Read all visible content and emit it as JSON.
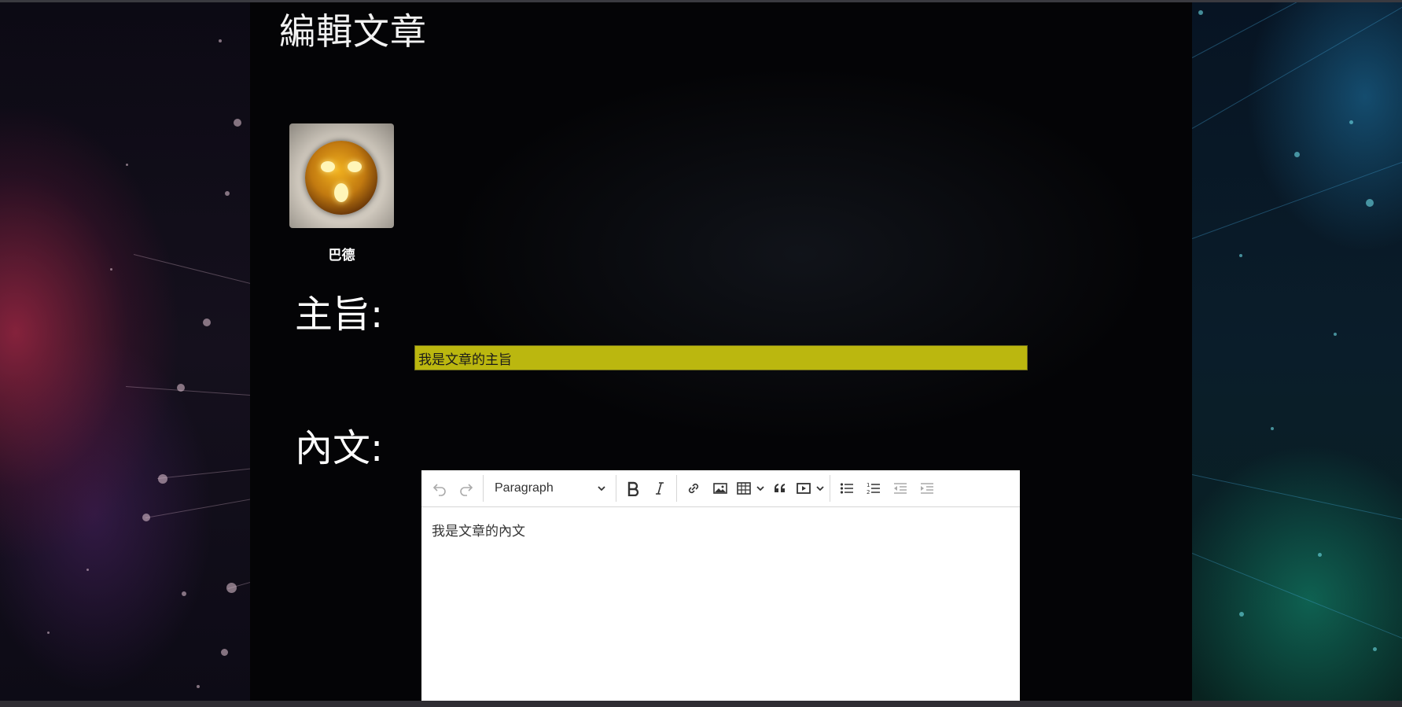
{
  "page": {
    "title": "編輯文章"
  },
  "author": {
    "name": "巴德",
    "avatar_icon": "bard-avatar-icon"
  },
  "form": {
    "subject_label": "主旨:",
    "subject_value": "我是文章的主旨",
    "content_label": "內文:",
    "subject_color": "#bbb70f"
  },
  "editor": {
    "heading_select": "Paragraph",
    "body_text": "我是文章的內文",
    "toolbar_icons": [
      "undo-icon",
      "redo-icon",
      "bold-icon",
      "italic-icon",
      "link-icon",
      "image-icon",
      "table-icon",
      "blockquote-icon",
      "media-embed-icon",
      "bulleted-list-icon",
      "numbered-list-icon",
      "outdent-icon",
      "indent-icon"
    ]
  }
}
